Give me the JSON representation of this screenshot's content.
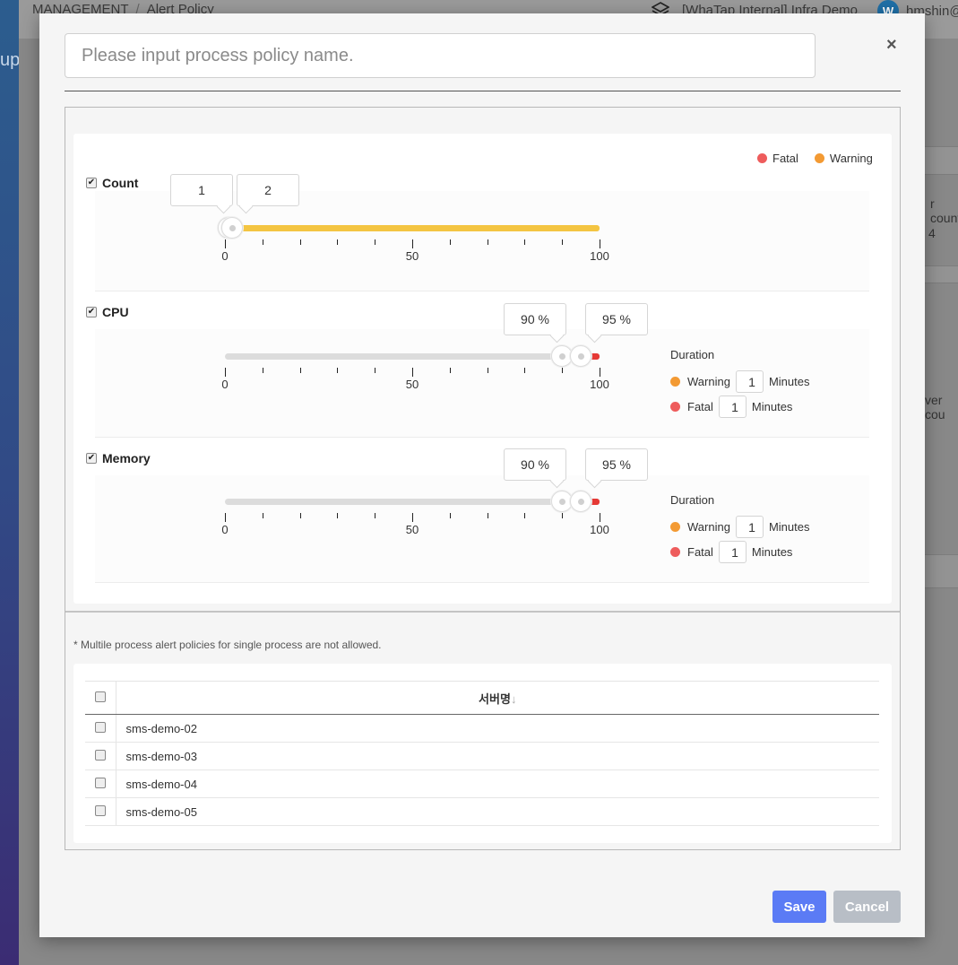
{
  "app": {
    "breadcrumb": [
      "MANAGEMENT",
      "Alert Policy"
    ],
    "breadcrumb_sep": "/",
    "project_name": "[WhaTap Internal] Infra Demo",
    "user_initial": "W",
    "user_name": "hmshin@",
    "sidebar_fragment": "up",
    "bg_fragments": [
      "r count",
      "4",
      "ver cou"
    ]
  },
  "modal": {
    "name_placeholder": "Please input process policy name.",
    "name_value": "",
    "close_label": "×",
    "legend": {
      "fatal": "Fatal",
      "warning": "Warning"
    },
    "colors": {
      "fatal": "#ee5c5c",
      "warning": "#f39a33",
      "count_fill": "#f4c542",
      "fatal_bar": "#e53935"
    },
    "axis": {
      "min": "0",
      "mid": "50",
      "max": "100"
    },
    "metrics": {
      "count": {
        "label": "Count",
        "checked": true,
        "low": "1",
        "high": "2",
        "low_value": 1,
        "high_value": 2
      },
      "cpu": {
        "label": "CPU",
        "checked": true,
        "low": "90 %",
        "high": "95 %",
        "low_value": 90,
        "high_value": 95,
        "duration_title": "Duration",
        "warning_label": "Warning",
        "warning_minutes": "1",
        "fatal_label": "Fatal",
        "fatal_minutes": "1",
        "unit": "Minutes"
      },
      "memory": {
        "label": "Memory",
        "checked": true,
        "low": "90 %",
        "high": "95 %",
        "low_value": 90,
        "high_value": 95,
        "duration_title": "Duration",
        "warning_label": "Warning",
        "warning_minutes": "1",
        "fatal_label": "Fatal",
        "fatal_minutes": "1",
        "unit": "Minutes"
      }
    },
    "notice": "* Multile process alert policies for single process are not allowed.",
    "server_table": {
      "header": "서버명",
      "sort_icon": "↓",
      "rows": [
        "sms-demo-02",
        "sms-demo-03",
        "sms-demo-04",
        "sms-demo-05"
      ]
    },
    "save_label": "Save",
    "cancel_label": "Cancel"
  }
}
